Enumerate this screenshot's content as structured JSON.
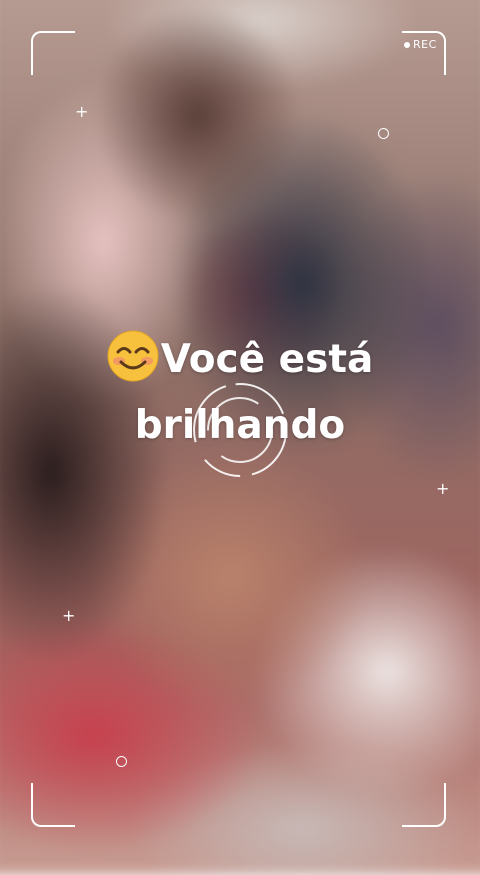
{
  "record_indicator": {
    "label": "REC"
  },
  "caption": {
    "emoji_icon": "smiling-face-with-smiling-eyes-icon",
    "line1": "Você está",
    "line2": "brilhando"
  },
  "colors": {
    "overlay": "#ffffff",
    "emoji_face": "#f7c13d",
    "emoji_blush": "#f28b6f"
  }
}
